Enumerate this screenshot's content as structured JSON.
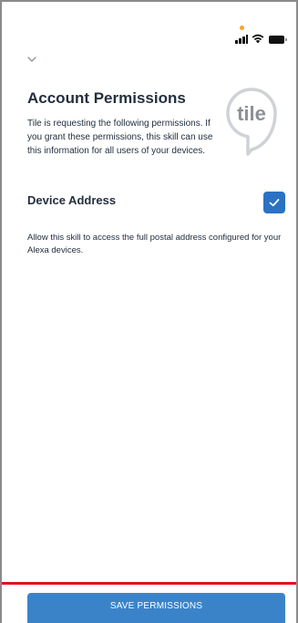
{
  "colors": {
    "accent": "#2a72c4",
    "button": "#3b83c9",
    "text": "#232f3e",
    "divider": "#e1141b",
    "status_dot": "#f5a623"
  },
  "status_bar": {
    "icons": [
      "signal-icon",
      "wifi-icon",
      "battery-icon"
    ]
  },
  "header": {
    "collapse_icon": "chevron-down-icon"
  },
  "page": {
    "title": "Account Permissions",
    "intro": "Tile is requesting the following permissions. If you grant these permissions, this skill can use this information for all users of your devices.",
    "logo_text": "tile"
  },
  "permissions": [
    {
      "title": "Device Address",
      "description": "Allow this skill to access the full postal address configured for your Alexa devices.",
      "checked": true
    }
  ],
  "footer": {
    "save_label": "SAVE PERMISSIONS"
  }
}
